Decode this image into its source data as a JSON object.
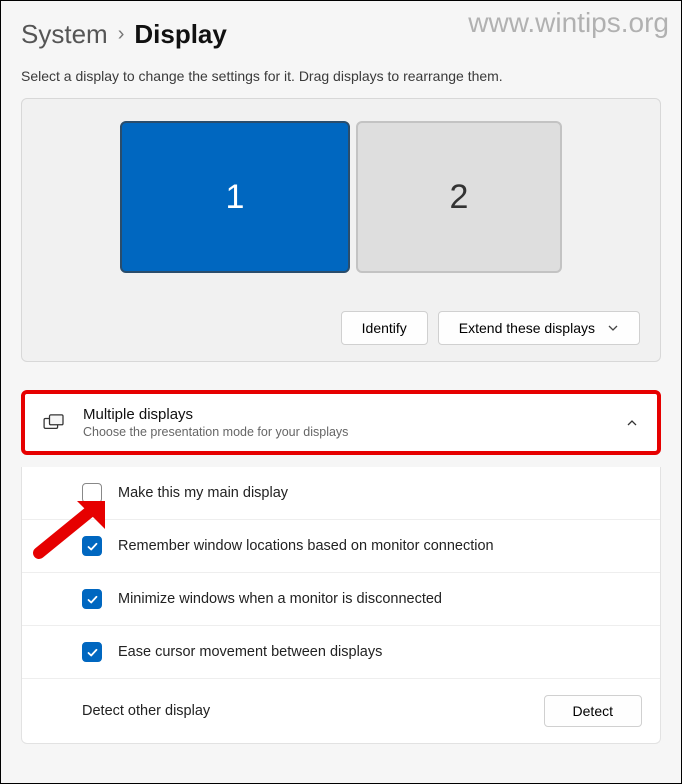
{
  "watermark": "www.wintips.org",
  "breadcrumb": {
    "system": "System",
    "display": "Display"
  },
  "hint": "Select a display to change the settings for it. Drag displays to rearrange them.",
  "monitors": {
    "one": "1",
    "two": "2"
  },
  "actions": {
    "identify": "Identify",
    "extend": "Extend these displays"
  },
  "section": {
    "title": "Multiple displays",
    "subtitle": "Choose the presentation mode for your displays"
  },
  "options": {
    "main": "Make this my main display",
    "remember": "Remember window locations based on monitor connection",
    "minimize": "Minimize windows when a monitor is disconnected",
    "ease": "Ease cursor movement between displays",
    "detect_label": "Detect other display",
    "detect_button": "Detect"
  }
}
